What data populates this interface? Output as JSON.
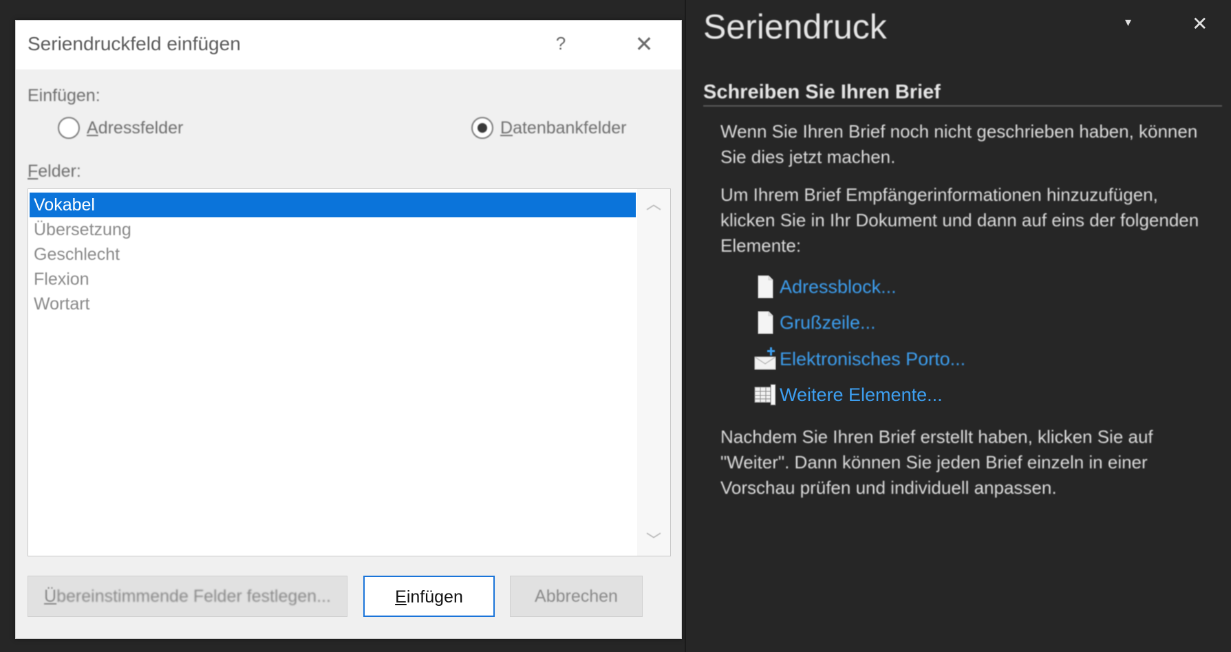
{
  "dialog": {
    "title": "Seriendruckfeld einfügen",
    "help_label": "?",
    "close_label": "✕",
    "insert_label": "Einfügen:",
    "radio_address": {
      "underlined": "A",
      "rest": "dressfelder",
      "checked": false
    },
    "radio_database": {
      "underlined": "D",
      "rest": "atenbankfelder",
      "checked": true
    },
    "fields_label_underlined": "F",
    "fields_label_rest": "elder:",
    "fields": [
      "Vokabel",
      "Übersetzung",
      "Geschlecht",
      "Flexion",
      "Wortart"
    ],
    "selected_index": 0,
    "scroll_up_icon": "chevron-up-icon",
    "scroll_down_icon": "chevron-down-icon",
    "buttons": {
      "match_underlined": "Ü",
      "match_rest": "bereinstimmende Felder festlegen...",
      "insert_underlined": "E",
      "insert_rest": "infügen",
      "cancel": "Abbrechen"
    },
    "accent_color": "#0b74da"
  },
  "task_pane": {
    "title": "Seriendruck",
    "menu_icon": "▾",
    "close_icon": "✕",
    "section_heading": "Schreiben Sie Ihren Brief",
    "para_1": "Wenn Sie Ihren Brief noch nicht geschrieben haben, können Sie dies jetzt machen.",
    "para_2": "Um Ihrem Brief Empfängerinformationen hinzuzufügen, klicken Sie in Ihr Dokument und dann auf eins der folgenden Elemente:",
    "links": [
      {
        "label": "Adressblock...",
        "icon": "document-icon"
      },
      {
        "label": "Grußzeile...",
        "icon": "document-icon"
      },
      {
        "label": "Elektronisches Porto...",
        "icon": "envelope-icon"
      },
      {
        "label": "Weitere Elemente...",
        "icon": "table-icon"
      }
    ],
    "para_3": "Nachdem Sie Ihren Brief erstellt haben, klicken Sie auf \"Weiter\". Dann können Sie jeden Brief einzeln in einer Vorschau prüfen und individuell anpassen.",
    "link_color": "#3d9ff0"
  }
}
